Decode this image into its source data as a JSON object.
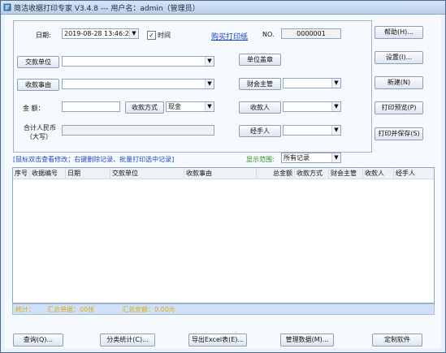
{
  "window": {
    "title": "简洁收据打印专家 V3.4.8 --- 用户名：admin（管理员）"
  },
  "form": {
    "date_label": "日期:",
    "date_value": "2019-08-28 13:46:23",
    "time_label": "时间",
    "time_checked": true,
    "buy_link": "购买打印纸",
    "no_label": "NO.",
    "no_value": "0000001",
    "payer_button": "交款单位",
    "reason_button": "收款事由",
    "amount_label": "金    额：",
    "payment_method_button": "收款方式",
    "payment_method_value": "现金",
    "total_rmb_label": "合计人民币",
    "total_rmb_label_2": "（大写）",
    "stamp_button": "单位盖章",
    "finance_manager_button": "财会主管",
    "payee_button": "收款人",
    "handler_button": "经手人"
  },
  "right_buttons": {
    "help": "帮助(H)...",
    "settings": "设置(I)...",
    "new": "新建(N)",
    "print_preview": "打印预览(P)",
    "print_save": "打印并保存(S)"
  },
  "hint_text": "[鼠标双击查看修改；右键删除记录、批量打印选中记录]",
  "range_label": "显示范围:",
  "range_value": "所有记录",
  "table": {
    "columns": [
      "序号",
      "收据编号",
      "日期",
      "交款单位",
      "收款事由",
      "总金额",
      "收款方式",
      "财会主管",
      "收款人",
      "经手人"
    ]
  },
  "status": {
    "label": "统计：",
    "receipts": "汇总单据：00张",
    "amount": "汇总金额：0.00元"
  },
  "bottom_buttons": {
    "query": "查询(Q)...",
    "category_stats": "分类统计(C)...",
    "export_excel": "导出Excel表(E)...",
    "manage_data": "管理数据(M)...",
    "custom_software": "定制软件"
  },
  "icons": {
    "app": "receipt-app-icon",
    "dropdown": "chevron-down-icon",
    "check": "checkmark-icon"
  }
}
